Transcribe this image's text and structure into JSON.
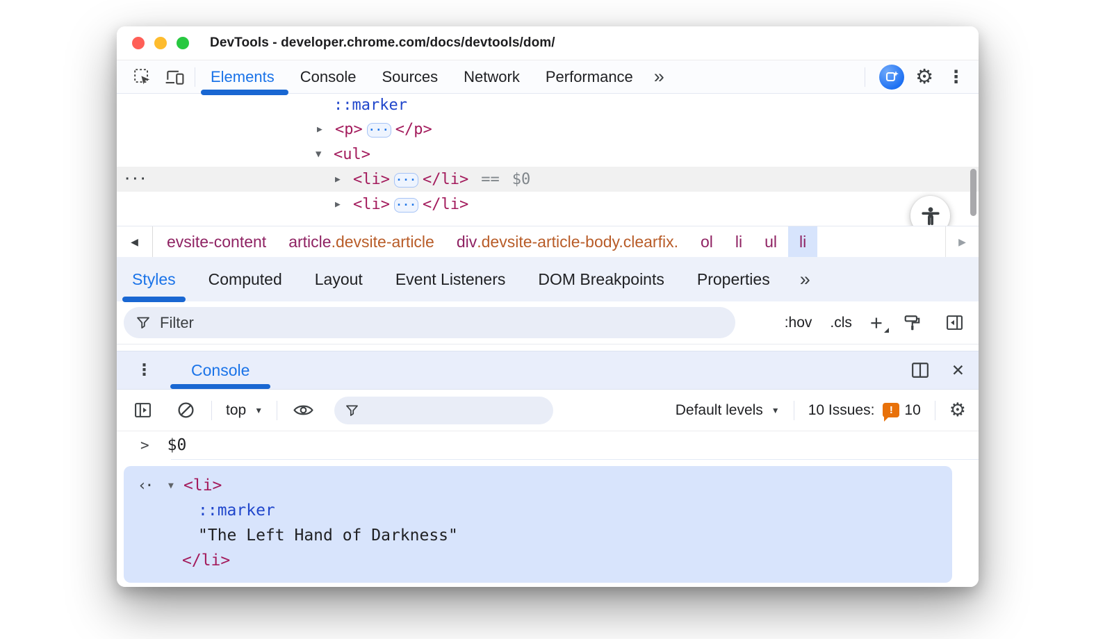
{
  "colors": {
    "accent": "#1a73e8",
    "tab_underline": "#1967d2",
    "code_tag": "#a31b5c",
    "code_pseudo": "#2046cb",
    "crumb_tag": "#8f2363",
    "crumb_class": "#b85c28",
    "result_highlight": "#d8e4fc",
    "selected_crumb_bg": "#d7e4fc",
    "issues_badge": "#e8710a",
    "traffic_red": "#ff5f57",
    "traffic_yellow": "#febc2e",
    "traffic_green": "#28c840"
  },
  "titlebar": {
    "title": "DevTools - developer.chrome.com/docs/devtools/dom/"
  },
  "main_tabs": {
    "items": [
      {
        "label": "Elements"
      },
      {
        "label": "Console"
      },
      {
        "label": "Sources"
      },
      {
        "label": "Network"
      },
      {
        "label": "Performance"
      }
    ],
    "more_label": "»"
  },
  "dom_tree": {
    "gutter_dots": "···",
    "ellipsis": "···",
    "marker_row": {
      "text": "::marker"
    },
    "p_row": {
      "twisty": "▶",
      "open": "<p>",
      "close": "</p>"
    },
    "ul_row": {
      "twisty": "▼",
      "open": "<ul>"
    },
    "li_selected_row": {
      "twisty": "▶",
      "open": "<li>",
      "close": "</li>",
      "eq": "==",
      "var": "$0"
    },
    "li_row": {
      "twisty": "▶",
      "open": "<li>",
      "close": "</li>"
    }
  },
  "breadcrumbs": {
    "back_arrow": "◀",
    "forward_arrow": "▶",
    "items": [
      {
        "tag": "evsite-content",
        "cls": ""
      },
      {
        "tag": "article",
        "cls": ".devsite-article"
      },
      {
        "tag": "div",
        "cls": ".devsite-article-body.clearfix."
      },
      {
        "tag": "ol",
        "cls": ""
      },
      {
        "tag": "li",
        "cls": ""
      },
      {
        "tag": "ul",
        "cls": ""
      },
      {
        "tag": "li",
        "cls": ""
      }
    ]
  },
  "styles_tabs": {
    "items": [
      {
        "label": "Styles"
      },
      {
        "label": "Computed"
      },
      {
        "label": "Layout"
      },
      {
        "label": "Event Listeners"
      },
      {
        "label": "DOM Breakpoints"
      },
      {
        "label": "Properties"
      }
    ],
    "more_label": "»"
  },
  "styles_toolbar": {
    "filter_placeholder": "Filter",
    "hov_label": ":hov",
    "cls_label": ".cls",
    "plus_label": "+"
  },
  "drawer": {
    "kebab": "⋮",
    "tab_label": "Console",
    "close": "✕"
  },
  "console_toolbar": {
    "context_label": "top",
    "caret": "▼",
    "levels_label": "Default levels",
    "issues_text": "10 Issues:",
    "issues_bang": "!",
    "issues_count": "10",
    "gear": "⚙"
  },
  "tabbar_icons": {
    "gear": "⚙",
    "kebab": "⋮"
  },
  "console": {
    "prompt": ">",
    "echo_value": "$0",
    "result": {
      "return_arrow": "‹·",
      "twisty": "▼",
      "open_tag": "<li>",
      "marker": "::marker",
      "string": "\"The Left Hand of Darkness\"",
      "close_tag": "</li>"
    }
  }
}
